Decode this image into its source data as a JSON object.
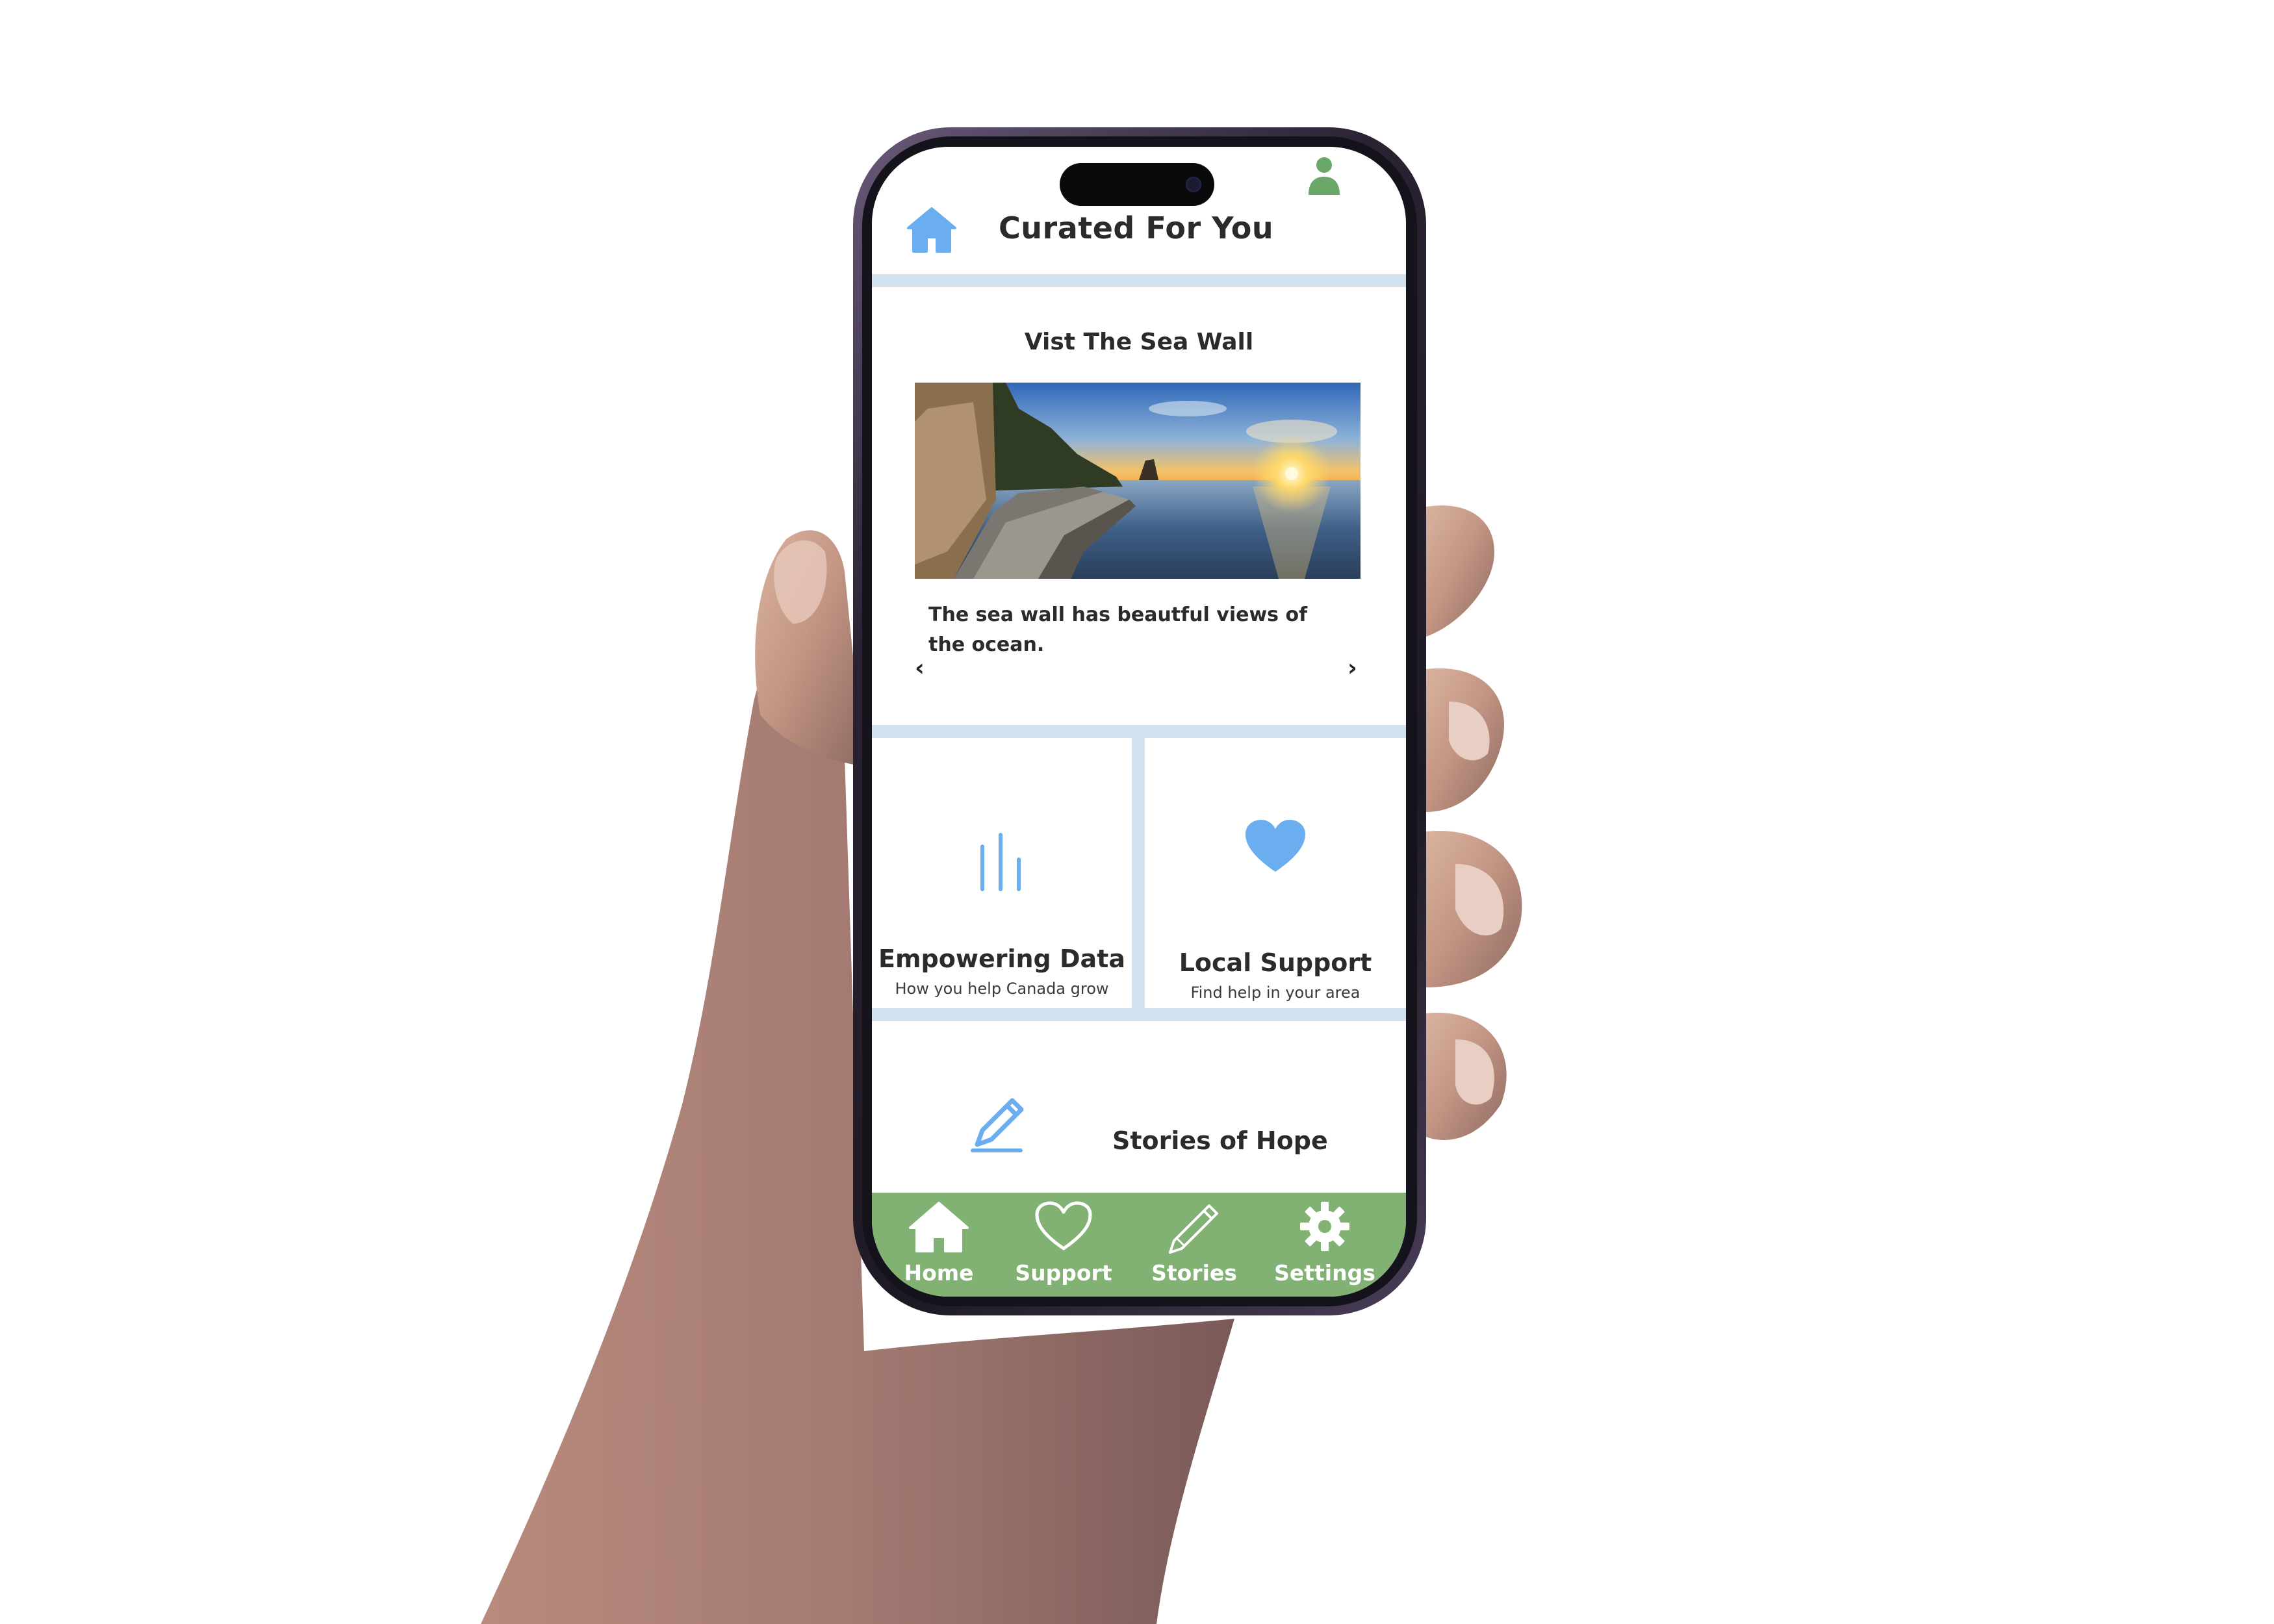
{
  "header": {
    "title": "Curated For You"
  },
  "featured": {
    "title": "Vist The Sea Wall",
    "caption": "The sea wall has beautful views of the ocean.",
    "prev_arrow": "‹",
    "next_arrow": "›"
  },
  "tiles": [
    {
      "title": "Empowering Data",
      "subtitle": "How you help Canada grow",
      "icon": "bar-chart-icon"
    },
    {
      "title": "Local Support",
      "subtitle": "Find help in your area",
      "icon": "heart-icon"
    }
  ],
  "stories": {
    "title": "Stories of Hope",
    "icon": "pencil-icon"
  },
  "tabbar": {
    "items": [
      {
        "label": "Home",
        "icon": "home-icon"
      },
      {
        "label": "Support",
        "icon": "heart-outline-icon"
      },
      {
        "label": "Stories",
        "icon": "pencil-icon"
      },
      {
        "label": "Settings",
        "icon": "gear-icon"
      }
    ]
  },
  "colors": {
    "accent_blue": "#6aaef0",
    "tab_green": "#82b174",
    "divider": "#d3e2ef",
    "profile_green": "#6aa86a"
  }
}
